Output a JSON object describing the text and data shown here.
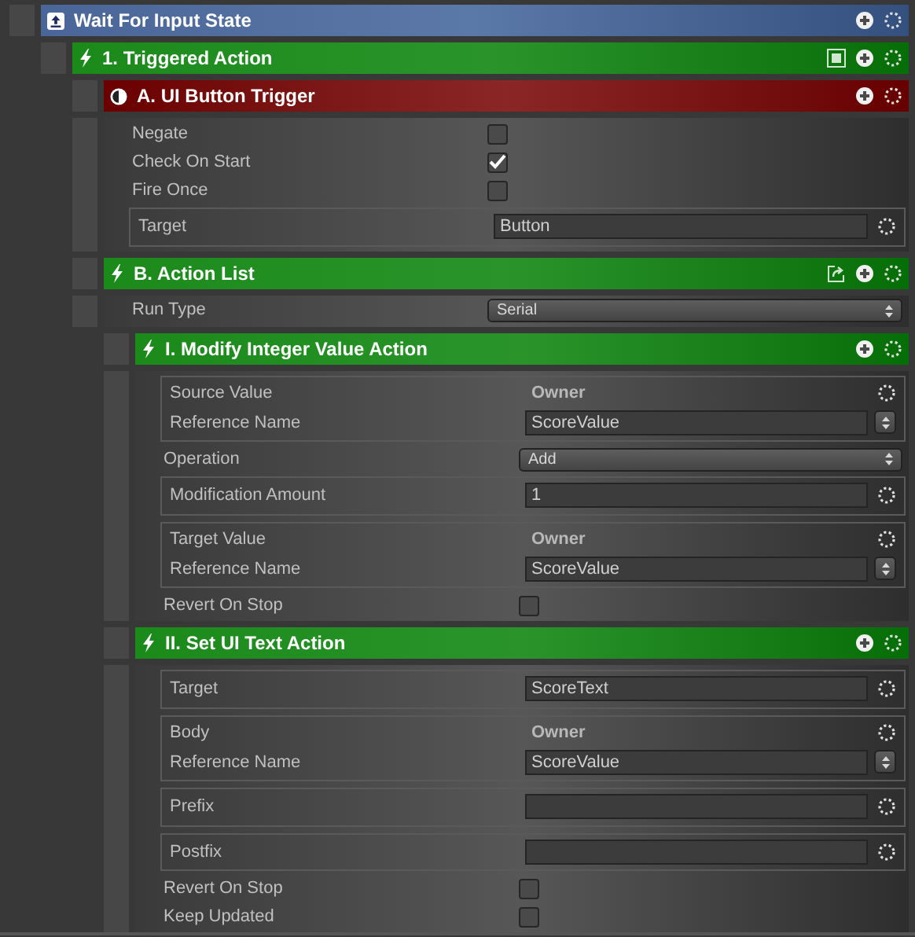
{
  "root": {
    "kind": "state",
    "title": "Wait For Input State",
    "children": [
      {
        "kind": "action",
        "title": "1. Triggered Action",
        "toggle_button": true,
        "children": [
          {
            "kind": "trigger",
            "title": "A. UI Button Trigger",
            "rows": [
              {
                "kind": "checkbox",
                "label": "Negate",
                "checked": false
              },
              {
                "kind": "checkbox",
                "label": "Check On Start",
                "checked": true
              },
              {
                "kind": "checkbox",
                "label": "Fire Once",
                "checked": false
              },
              {
                "kind": "field",
                "label": "Target",
                "value": "Button"
              }
            ]
          },
          {
            "kind": "action",
            "title": "B. Action List",
            "export_button": true,
            "rows": [
              {
                "kind": "dropdown",
                "label": "Run Type",
                "value": "Serial"
              }
            ],
            "children": [
              {
                "kind": "action",
                "title": "I. Modify Integer Value Action",
                "rows": [
                  {
                    "kind": "reference",
                    "label": "Source Value",
                    "source": "Owner",
                    "ref_label": "Reference Name",
                    "ref_value": "ScoreValue"
                  },
                  {
                    "kind": "dropdown",
                    "label": "Operation",
                    "value": "Add"
                  },
                  {
                    "kind": "field",
                    "label": "Modification Amount",
                    "value": "1"
                  },
                  {
                    "kind": "reference",
                    "label": "Target Value",
                    "source": "Owner",
                    "ref_label": "Reference Name",
                    "ref_value": "ScoreValue"
                  },
                  {
                    "kind": "checkbox",
                    "label": "Revert On Stop",
                    "checked": false
                  }
                ]
              },
              {
                "kind": "action",
                "title": "II. Set UI Text Action",
                "rows": [
                  {
                    "kind": "field",
                    "label": "Target",
                    "value": "ScoreText"
                  },
                  {
                    "kind": "reference",
                    "label": "Body",
                    "source": "Owner",
                    "ref_label": "Reference Name",
                    "ref_value": "ScoreValue"
                  },
                  {
                    "kind": "field",
                    "label": "Prefix"
                  },
                  {
                    "kind": "field",
                    "label": "Postfix"
                  },
                  {
                    "kind": "checkbox",
                    "label": "Revert On Stop",
                    "checked": false
                  },
                  {
                    "kind": "checkbox",
                    "label": "Keep Updated",
                    "checked": false
                  }
                ]
              }
            ]
          }
        ]
      }
    ]
  }
}
